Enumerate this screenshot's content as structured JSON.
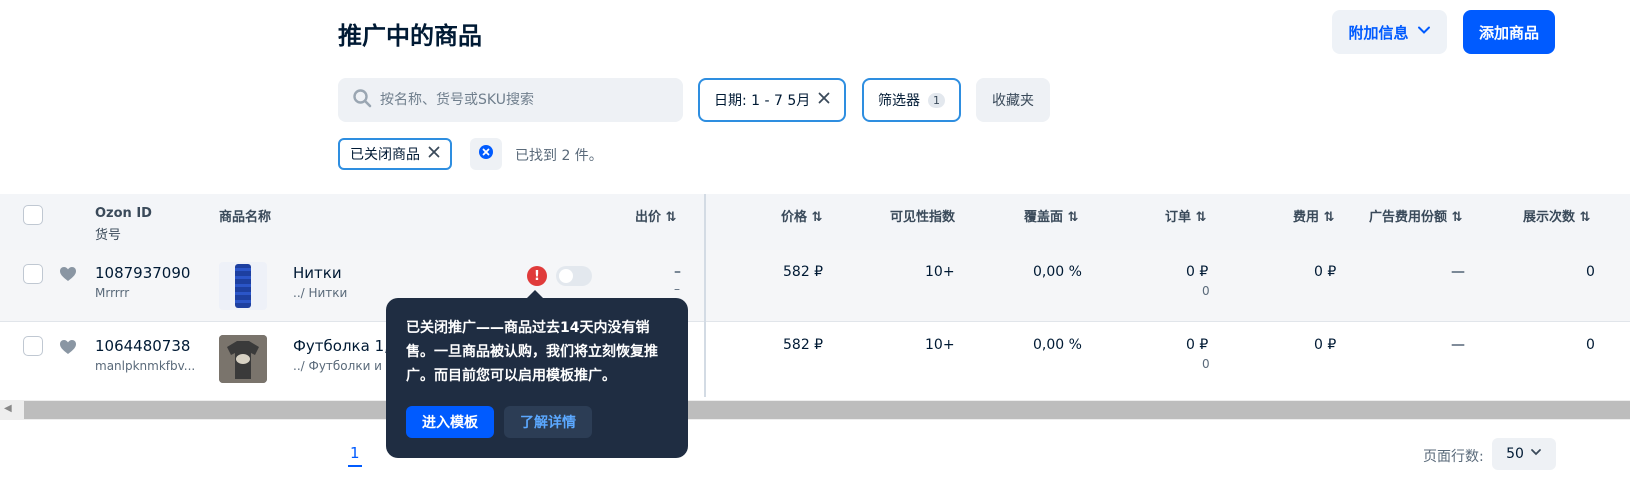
{
  "header": {
    "title": "推广中的商品",
    "extra_info_label": "附加信息",
    "add_product_label": "添加商品"
  },
  "filters": {
    "search_placeholder": "按名称、货号或SKU搜索",
    "search_value": "",
    "date_chip": "日期: 1 - 7 5月",
    "filter_label": "筛选器",
    "filter_count": "1",
    "favorites_label": "收藏夹",
    "active_tag": "已关闭商品",
    "found_text": "已找到 2 件。"
  },
  "table": {
    "headers": {
      "ozon_id": "Ozon ID",
      "sku": "货号",
      "name": "商品名称",
      "bid": "出价 ⇅",
      "price": "价格 ⇅",
      "visibility": "可见性指数",
      "coverage": "覆盖面 ⇅",
      "orders": "订单 ⇅",
      "cost": "费用 ⇅",
      "ad_share": "广告费用份额 ⇅",
      "impressions": "展示次数 ⇅"
    },
    "rows": [
      {
        "ozon_id": "1087937090",
        "sku": "Mrrrrr",
        "name": "Нитки",
        "category": "../ Нитки",
        "bid": "–",
        "bid_sub": "–",
        "price": "582 ₽",
        "visibility": "10+",
        "coverage": "0,00 %",
        "orders": "0 ₽",
        "orders_sub": "0",
        "cost": "0 ₽",
        "ad_share": "—",
        "impressions": "0"
      },
      {
        "ozon_id": "1064480738",
        "sku": "manlpknmkfbv...",
        "name": "Футболка 1,",
        "category": "../ Футболки и",
        "price": "582 ₽",
        "visibility": "10+",
        "coverage": "0,00 %",
        "orders": "0 ₽",
        "orders_sub": "0",
        "cost": "0 ₽",
        "ad_share": "—",
        "impressions": "0"
      }
    ]
  },
  "tooltip": {
    "text": "已关闭推广——商品过去14天内没有销售。一旦商品被认购，我们将立刻恢复推广。而目前您可以启用模板推广。",
    "primary_label": "进入模板",
    "secondary_label": "了解详情"
  },
  "pagination": {
    "current_page": "1",
    "rows_per_page_label": "页面行数:",
    "rows_per_page_value": "50"
  },
  "colors": {
    "accent": "#005bff",
    "tooltip_bg": "#1f2d42",
    "warning": "#e03b3b",
    "chip_border": "#2e8ee0"
  }
}
